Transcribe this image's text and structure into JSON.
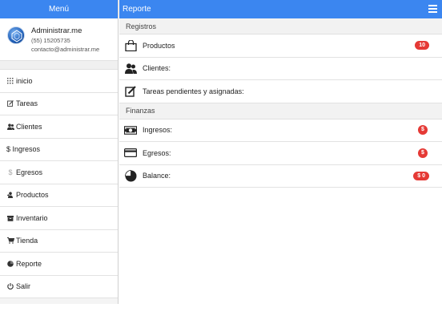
{
  "menu": {
    "title": "Menú",
    "profile": {
      "name": "Administrar.me",
      "phone": "(55) 15205735",
      "email": "contacto@administrar.me"
    },
    "items": [
      {
        "label": "inicio",
        "icon": "grid-icon"
      },
      {
        "label": "Tareas",
        "icon": "edit-icon"
      },
      {
        "label": "Clientes",
        "icon": "users-icon"
      },
      {
        "label": "$ Ingresos",
        "icon": ""
      },
      {
        "label": "Egresos",
        "icon": "dollar-outline-icon"
      },
      {
        "label": "Productos",
        "icon": "user-plus-icon"
      },
      {
        "label": "Inventario",
        "icon": "box-icon"
      },
      {
        "label": "Tienda",
        "icon": "cart-icon"
      },
      {
        "label": "Reporte",
        "icon": "pie-icon"
      },
      {
        "label": "Salir",
        "icon": "power-icon"
      }
    ]
  },
  "header": {
    "title": "Reporte"
  },
  "registros": {
    "title": "Registros",
    "rows": [
      {
        "label": "Productos",
        "badge": "10",
        "icon": "bag-icon"
      },
      {
        "label": "Clientes:",
        "badge": "",
        "icon": "users-icon"
      },
      {
        "label": "Tareas pendientes y asignadas:",
        "badge": "",
        "icon": "edit-icon"
      }
    ]
  },
  "finanzas": {
    "title": "Finanzas",
    "rows": [
      {
        "label": "Ingresos:",
        "badge": "$",
        "icon": "money-icon"
      },
      {
        "label": "Egresos:",
        "badge": "$",
        "icon": "credit-card-icon"
      },
      {
        "label": "Balance:",
        "badge": "$ 0",
        "icon": "pie-chart-icon"
      }
    ]
  },
  "colors": {
    "accent": "#3b86f0",
    "badge": "#e53935"
  }
}
